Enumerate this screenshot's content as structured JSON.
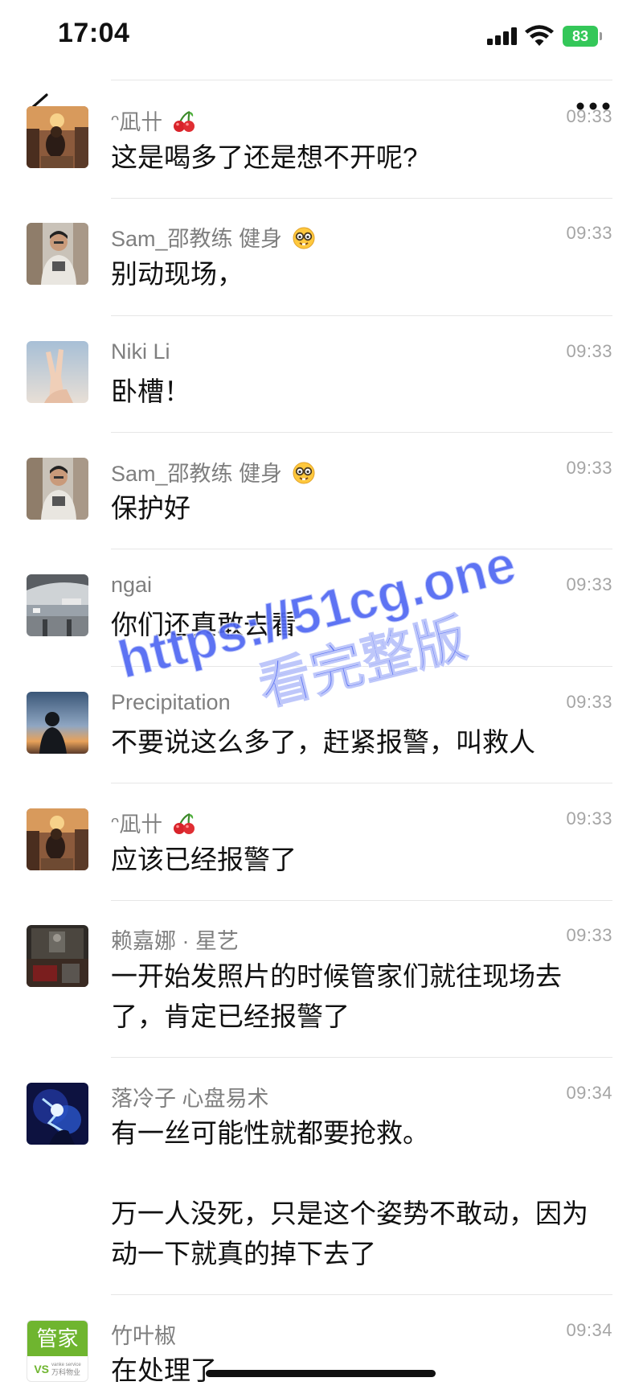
{
  "status_bar": {
    "time": "17:04",
    "battery": "83"
  },
  "messages": [
    {
      "name": "ᵔ凪卄",
      "emoji": "cherry",
      "time": "09:33",
      "text": "这是喝多了还是想不开呢?"
    },
    {
      "name": "Sam_邵教练 健身",
      "emoji": "nerd-face",
      "time": "09:33",
      "text": "别动现场，"
    },
    {
      "name": "Niki Li",
      "emoji": "",
      "time": "09:33",
      "text": "卧槽！"
    },
    {
      "name": "Sam_邵教练 健身",
      "emoji": "nerd-face",
      "time": "09:33",
      "text": "保护好"
    },
    {
      "name": "ngai",
      "emoji": "",
      "time": "09:33",
      "text": "你们还真敢去看"
    },
    {
      "name": "Precipitation",
      "emoji": "",
      "time": "09:33",
      "text": "不要说这么多了，赶紧报警，叫救人"
    },
    {
      "name": "ᵔ凪卄",
      "emoji": "cherry",
      "time": "09:33",
      "text": "应该已经报警了"
    },
    {
      "name": "赖嘉娜 · 星艺",
      "emoji": "",
      "time": "09:33",
      "text": "一开始发照片的时候管家们就往现场去\n了，肯定已经报警了"
    },
    {
      "name": "落冷子  心盘易术",
      "emoji": "",
      "time": "09:34",
      "text": "有一丝可能性就都要抢救。\n\n万一人没死，只是这个姿势不敢动，因为\n动一下就真的掉下去了"
    },
    {
      "name": "竹叶椒",
      "emoji": "",
      "time": "09:34",
      "text": "在处理了"
    }
  ],
  "avatar_badge": {
    "label": "管家",
    "brand": "万科物业",
    "brand_en": "vanke service",
    "logo": "VS"
  },
  "watermark": {
    "line1": "https://51cg.one",
    "line2": "看完整版",
    "color": "#4f67f2"
  },
  "colors": {
    "name": "#7f7f7f",
    "time": "#a5a5a5",
    "divider": "#e6e6e6",
    "battery": "#34c759"
  }
}
